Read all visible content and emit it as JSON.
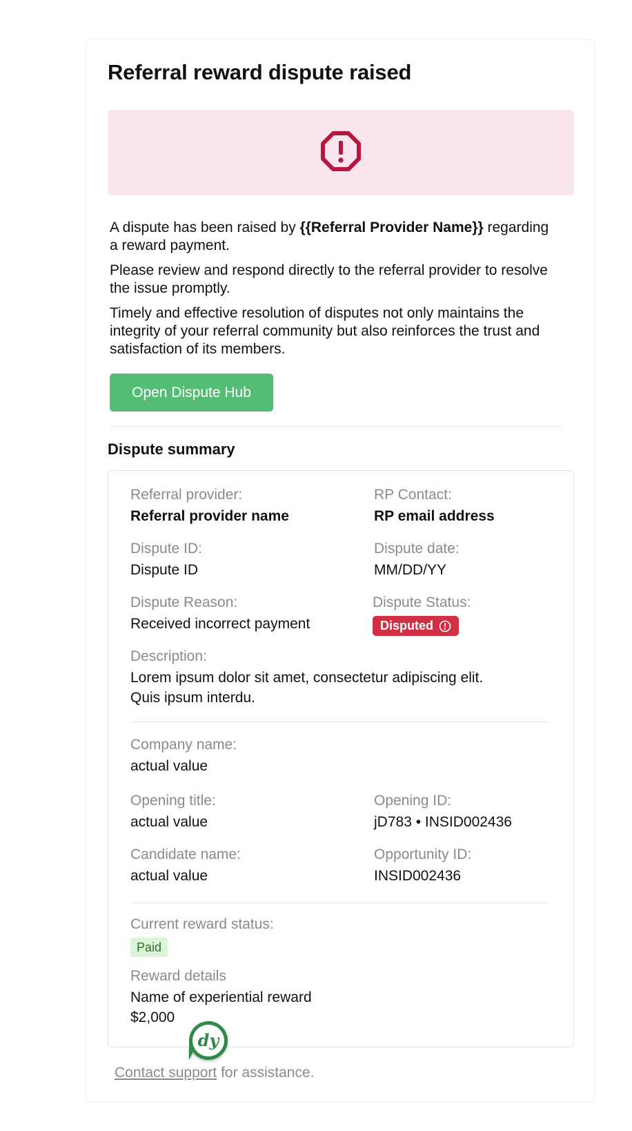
{
  "email": {
    "title": "Referral reward dispute raised",
    "intro_prefix": "A dispute has been raised by ",
    "provider_placeholder": "{{Referral Provider Name}}",
    "intro_suffix": " regarding a reward payment.",
    "paragraph2": "Please review and respond directly to the referral provider to resolve the issue promptly.",
    "paragraph3": "Timely and effective resolution of disputes not only maintains the integrity of your referral community but also reinforces the trust and satisfaction of its members.",
    "button_label": "Open Dispute Hub",
    "summary_heading": "Dispute summary"
  },
  "summary": {
    "referral_provider_label": "Referral provider:",
    "referral_provider_value": "Referral provider name",
    "rp_contact_label": "RP Contact:",
    "rp_contact_value": "RP email address",
    "dispute_id_label": "Dispute ID:",
    "dispute_id_value": "Dispute ID",
    "dispute_date_label": "Dispute date:",
    "dispute_date_value": "MM/DD/YY",
    "dispute_reason_label": "Dispute Reason:",
    "dispute_reason_value": "Received incorrect payment",
    "dispute_status_label": "Dispute Status:",
    "dispute_status_value": "Disputed",
    "description_label": "Description:",
    "description_value": "Lorem ipsum dolor sit amet, consectetur adipiscing elit. Quis ipsum interdu.",
    "company_name_label": "Company name:",
    "company_name_value": "actual value",
    "opening_title_label": "Opening title:",
    "opening_title_value": "actual value",
    "opening_id_label": "Opening ID:",
    "opening_id_value": "jD783 • INSID002436",
    "candidate_name_label": "Candidate name:",
    "candidate_name_value": "actual value",
    "opportunity_id_label": "Opportunity ID:",
    "opportunity_id_value": "INSID002436",
    "reward_status_label": "Current reward status:",
    "reward_status_value": "Paid",
    "reward_details_label": "Reward details",
    "reward_name_value": "Name of experiential reward",
    "reward_amount_value": "$2,000"
  },
  "footer": {
    "link_label": "Contact support",
    "suffix": " for assistance."
  },
  "icons": {
    "banner_icon": "alert-octagon-icon",
    "status_icon": "alert-circle-icon",
    "logo": "dy-logo"
  },
  "colors": {
    "banner_bg": "#fbe6f0",
    "alert_icon": "#b5173f",
    "button_bg": "#53bd75",
    "disputed_badge": "#d12f44",
    "paid_badge_bg": "#dbf5d9",
    "logo_green": "#2f8a4a"
  }
}
